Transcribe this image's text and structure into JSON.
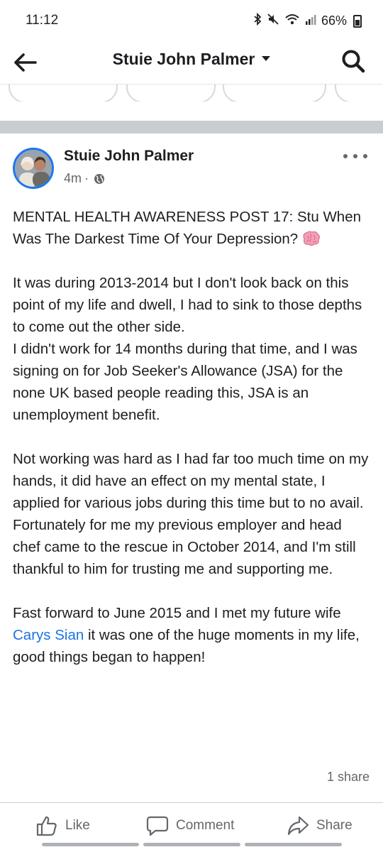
{
  "status_bar": {
    "time": "11:12",
    "battery": "66%",
    "icons": [
      "bluetooth-icon",
      "mute-icon",
      "wifi-icon",
      "signal-icon",
      "battery-icon"
    ]
  },
  "header": {
    "title": "Stuie John Palmer",
    "back_icon": "arrow-left-icon",
    "dropdown_icon": "caret-down-icon",
    "search_icon": "search-icon"
  },
  "post": {
    "author": "Stuie John Palmer",
    "time": "4m",
    "separator": "·",
    "privacy_icon": "globe-icon",
    "paragraphs": [
      "MENTAL HEALTH AWARENESS POST 17: Stu When Was The Darkest Time Of Your Depression?",
      "It was during 2013-2014 but I don't look back on this point of my life and dwell, I had to sink to those depths to come out the other side.",
      "I didn't work for 14 months during that time, and I was signing on for Job Seeker's Allowance (JSA) for the none UK based people reading this, JSA is an unemployment benefit.",
      "Not working was hard as I had far too much time on my hands, it did have an effect on my mental state, I applied for various jobs during this time but to no avail.",
      "Fortunately for me my previous employer and head chef came to the rescue in October 2014, and I'm still thankful to him for trusting me and supporting me.",
      "Fast forward to June 2015 and I met my future wife",
      "Carys Sian",
      "it was one of the huge moments in my life, good things began to happen!"
    ],
    "share_count": "1 share",
    "actions": {
      "like": "Like",
      "comment": "Comment",
      "share": "Share"
    }
  },
  "colors": {
    "accent": "#1877f2",
    "link": "#1b74e4",
    "secondary_text": "#65676b",
    "divider": "#c9ccd1"
  }
}
